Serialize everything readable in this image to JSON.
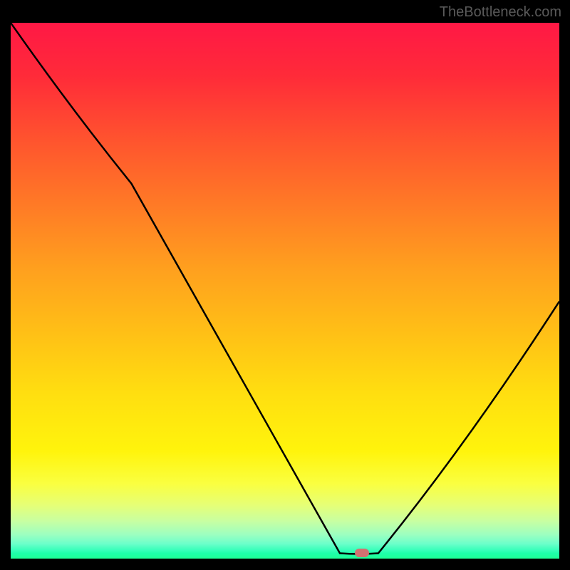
{
  "watermark": "TheBottleneck.com",
  "chart_data": {
    "type": "line",
    "title": "",
    "xlabel": "",
    "ylabel": "",
    "xlim": [
      0,
      100
    ],
    "ylim": [
      0,
      100
    ],
    "grid": false,
    "curve": [
      {
        "x": 0,
        "y": 100
      },
      {
        "x": 22,
        "y": 70
      },
      {
        "x": 60,
        "y": 1
      },
      {
        "x": 67,
        "y": 1
      },
      {
        "x": 100,
        "y": 48
      }
    ],
    "background_gradient_stops": [
      {
        "pos": 0,
        "color": "#ff1845"
      },
      {
        "pos": 10,
        "color": "#ff2b39"
      },
      {
        "pos": 22,
        "color": "#ff542e"
      },
      {
        "pos": 34,
        "color": "#ff7a26"
      },
      {
        "pos": 46,
        "color": "#ffa01e"
      },
      {
        "pos": 58,
        "color": "#ffc016"
      },
      {
        "pos": 69,
        "color": "#ffde10"
      },
      {
        "pos": 80,
        "color": "#fff40c"
      },
      {
        "pos": 86,
        "color": "#faff40"
      },
      {
        "pos": 90,
        "color": "#e6ff76"
      },
      {
        "pos": 93,
        "color": "#c8ffa2"
      },
      {
        "pos": 95.5,
        "color": "#9dffc0"
      },
      {
        "pos": 97.2,
        "color": "#6dffca"
      },
      {
        "pos": 98.3,
        "color": "#3dffbc"
      },
      {
        "pos": 99,
        "color": "#1effaa"
      },
      {
        "pos": 100,
        "color": "#1eff96"
      }
    ],
    "marker": {
      "x": 64,
      "y": 1,
      "color": "#d27171"
    }
  }
}
